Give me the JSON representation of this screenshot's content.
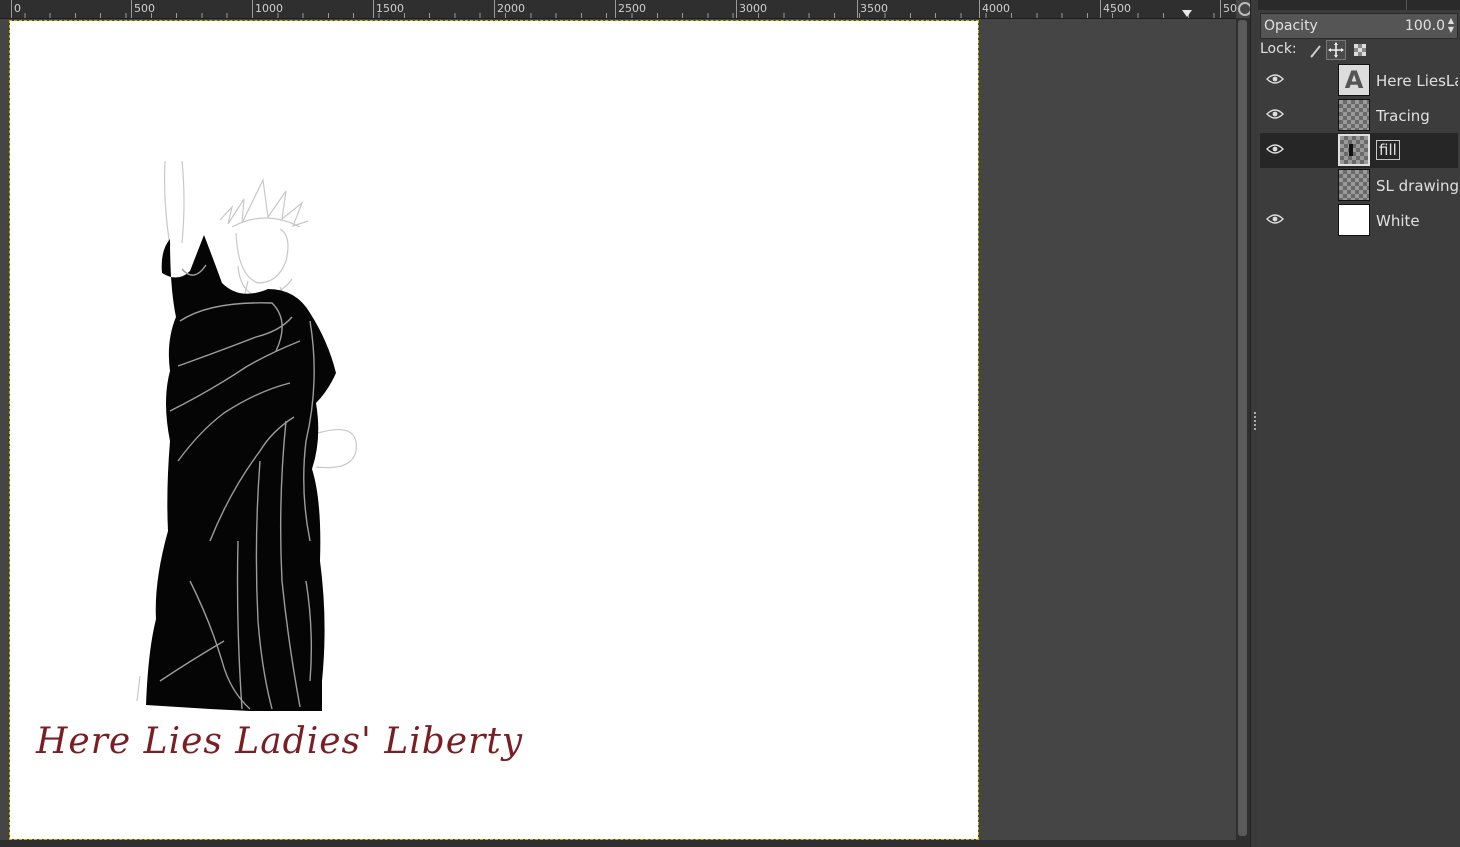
{
  "ruler": {
    "ticks": [
      {
        "label": "0"
      },
      {
        "label": "500"
      },
      {
        "label": "1000"
      },
      {
        "label": "1500"
      },
      {
        "label": "2000"
      },
      {
        "label": "2500"
      },
      {
        "label": "3000"
      },
      {
        "label": "3500"
      },
      {
        "label": "4000"
      },
      {
        "label": "4500"
      },
      {
        "label": "50"
      }
    ]
  },
  "canvas": {
    "text": "Here Lies Ladies' Liberty",
    "text_color": "#7a1e24"
  },
  "layers_panel": {
    "opacity_label": "Opacity",
    "opacity_value": "100.0",
    "lock_label": "Lock:",
    "layers": [
      {
        "name": "Here LiesLa",
        "visible": true,
        "thumb": "text"
      },
      {
        "name": "Tracing",
        "visible": true,
        "thumb": "checker"
      },
      {
        "name": "fill",
        "visible": true,
        "thumb": "checker",
        "active": true
      },
      {
        "name": "SL drawing",
        "visible": false,
        "thumb": "checker"
      },
      {
        "name": "White",
        "visible": true,
        "thumb": "white"
      }
    ]
  }
}
